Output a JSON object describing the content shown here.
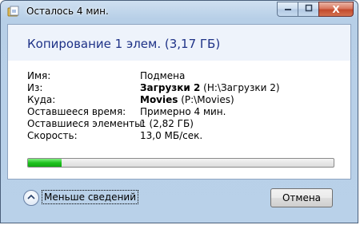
{
  "window": {
    "title": "Осталось 4 мин.",
    "icon": "copy-folder-icon",
    "controls": {
      "minimize_icon": "minimize-icon",
      "maximize_icon": "maximize-icon",
      "close_glyph": "X"
    }
  },
  "dialog": {
    "heading": "Копирование 1 элем. (3,17 ГБ)",
    "details": {
      "name": {
        "label": "Имя:",
        "value": "Подмена"
      },
      "from": {
        "label": "Из:",
        "value_bold": "Загрузки 2",
        "value_rest": " (H:\\Загрузки 2)"
      },
      "to": {
        "label": "Куда:",
        "value_bold": "Movies",
        "value_rest": " (P:\\Movies)"
      },
      "time_left": {
        "label": "Оставшееся время:",
        "value": "Примерно 4 мин."
      },
      "items_left": {
        "label": "Оставшиеся элементы:",
        "value": "1 (2,82 ГБ)"
      },
      "speed": {
        "label": "Скорость:",
        "value": "13,0 МБ/сек."
      }
    },
    "progress_fraction": 0.11
  },
  "footer": {
    "less_details_label": "Меньше сведений",
    "cancel_label": "Отмена"
  },
  "colors": {
    "heading": "#1e3287",
    "progress_green": "#1fc21f",
    "frame_blue": "#b9d1e9"
  }
}
